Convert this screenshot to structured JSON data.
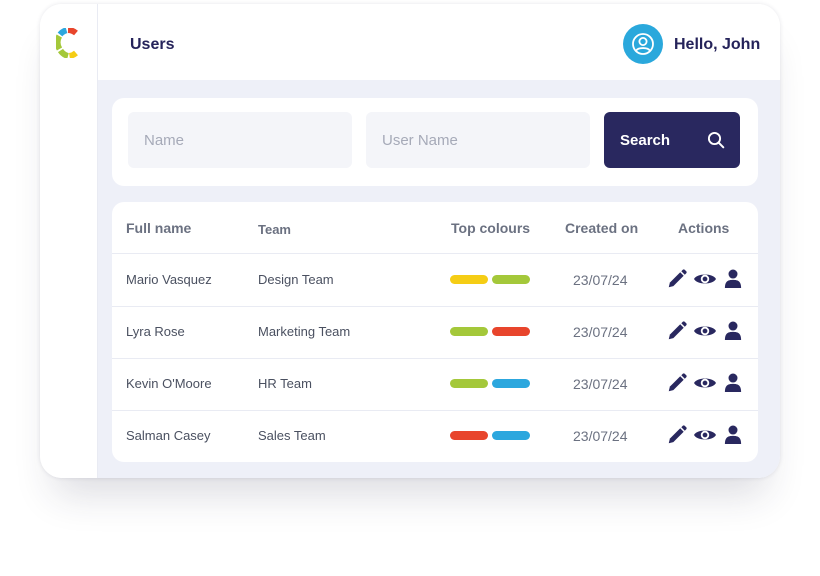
{
  "header": {
    "title": "Users",
    "greeting": "Hello, John"
  },
  "search": {
    "name_placeholder": "Name",
    "username_placeholder": "User Name",
    "button_label": "Search"
  },
  "table": {
    "columns": {
      "full_name": "Full name",
      "team": "Team",
      "top_colours": "Top colours",
      "created_on": "Created on",
      "actions": "Actions"
    },
    "rows": [
      {
        "name": "Mario Vasquez",
        "team": "Design Team",
        "colours": [
          "#f5cd15",
          "#a4c83a"
        ],
        "created": "23/07/24"
      },
      {
        "name": "Lyra Rose",
        "team": "Marketing Team",
        "colours": [
          "#a4c83a",
          "#e8452c"
        ],
        "created": "23/07/24"
      },
      {
        "name": "Kevin O'Moore",
        "team": "HR Team",
        "colours": [
          "#a4c83a",
          "#2ca7de"
        ],
        "created": "23/07/24"
      },
      {
        "name": "Salman Casey",
        "team": "Sales Team",
        "colours": [
          "#e8452c",
          "#2ca7de"
        ],
        "created": "23/07/24"
      }
    ],
    "row_actions": [
      "edit-icon",
      "view-icon",
      "user-icon"
    ]
  },
  "icons": {
    "logo": "logo-icon",
    "avatar": "user-avatar-icon",
    "search": "search-icon"
  },
  "colors": {
    "primary": "#29285f",
    "accent": "#2aa8dc",
    "text_dark": "#25235a",
    "background": "#eef0f8"
  }
}
